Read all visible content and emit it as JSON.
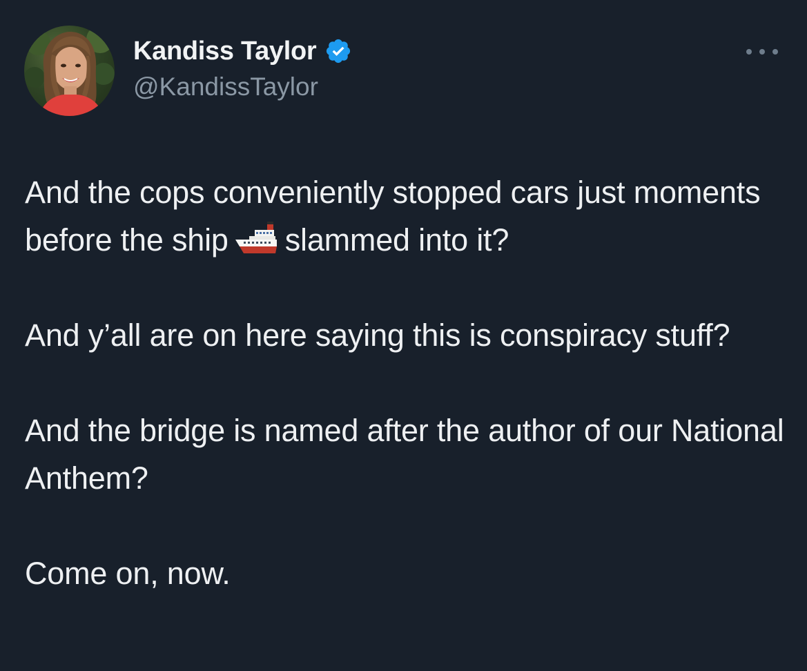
{
  "author": {
    "display_name": "Kandiss Taylor",
    "handle": "@KandissTaylor",
    "verified": true,
    "avatar_icon": "profile-photo",
    "verified_icon": "verified-badge-icon"
  },
  "actions": {
    "more_icon": "more-options-icon"
  },
  "tweet": {
    "p1_before_emoji": "And the cops conveniently stopped cars just moments before the ship",
    "emoji": "ship-emoji",
    "p1_after_emoji": "slammed into it?",
    "p2": "And y’all are on here saying this is conspiracy stuff?",
    "p3": "And the bridge is named after the author of our National Anthem?",
    "p4": "Come on, now."
  },
  "colors": {
    "background": "#18202b",
    "text": "#eef0f2",
    "secondary_text": "#8b98a5",
    "verified_blue": "#1d9bf0"
  }
}
